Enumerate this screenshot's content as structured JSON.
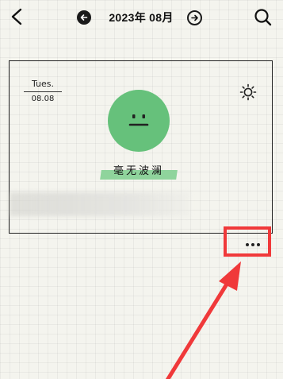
{
  "header": {
    "month_title": "2023年 08月"
  },
  "entry": {
    "day_name": "Tues.",
    "date": "08.08",
    "mood_label": "毫无波澜",
    "mood_color": "#66c17b",
    "weather_icon": "sun-icon"
  },
  "annotation": {
    "color": "#f0393a"
  }
}
